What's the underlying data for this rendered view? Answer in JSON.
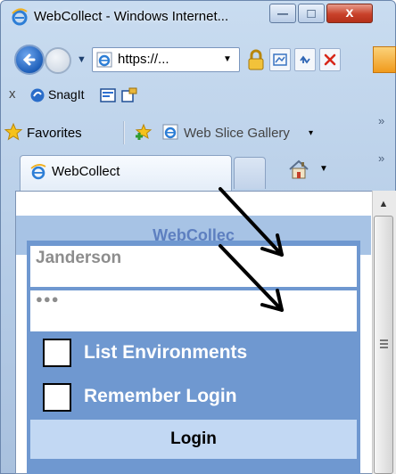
{
  "window": {
    "title": "WebCollect - Windows Internet...",
    "minimize_glyph": "—",
    "maximize_glyph": "□",
    "close_glyph": "x"
  },
  "address_bar": {
    "url": "https://...",
    "drop_glyph": "▼"
  },
  "snagit_toolbar": {
    "close_glyph": "x",
    "snagit_label": "SnagIt"
  },
  "favorites_bar": {
    "favorites_label": "Favorites",
    "web_slice_label": "Web Slice Gallery",
    "drop_glyph": "▾",
    "chevron": "»"
  },
  "tabs": {
    "active_label": "WebCollect",
    "chevron": "»"
  },
  "page": {
    "title": "WebCollec",
    "username_value": "Janderson",
    "password_mask": "●●●",
    "checkboxes": [
      {
        "label": "List Environments",
        "checked": false
      },
      {
        "label": "Remember Login",
        "checked": false
      }
    ],
    "login_label": "Login"
  },
  "scrollbar": {
    "up_glyph": "▲"
  },
  "icons": {
    "ie": "ie-logo-icon",
    "back": "back-arrow-icon",
    "lock": "lock-icon",
    "home": "home-icon",
    "favorites_star": "favorites-star-icon"
  },
  "colors": {
    "form_panel": "#6f98d0",
    "page_header": "#a7c3e5",
    "page_title": "#5d7fc0",
    "login_button": "#c2d8f3"
  }
}
